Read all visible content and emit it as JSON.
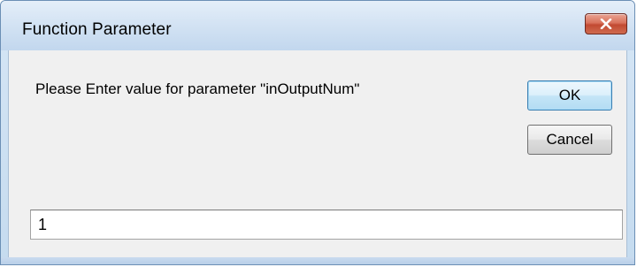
{
  "window": {
    "title": "Function Parameter",
    "close_icon": "close-icon"
  },
  "dialog": {
    "prompt": "Please Enter value for parameter \"inOutputNum\"",
    "ok_label": "OK",
    "cancel_label": "Cancel",
    "input_value": "1"
  },
  "colors": {
    "title_bar": "#cfe0f2",
    "client_bg": "#f0f0f0",
    "close_button": "#c24a32",
    "default_button_border": "#3c7fb1"
  }
}
